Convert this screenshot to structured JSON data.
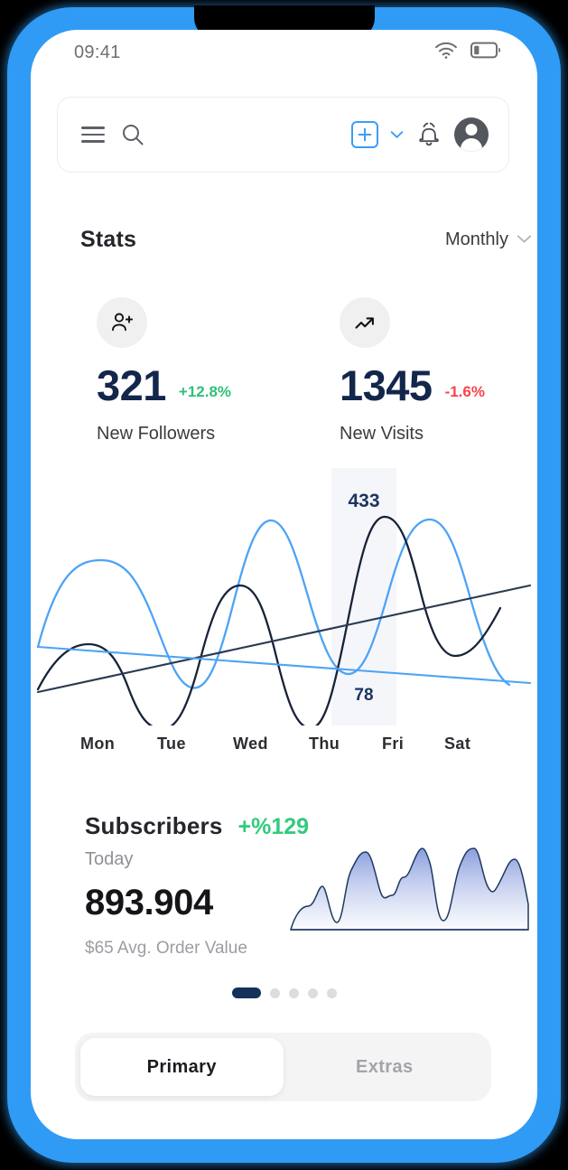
{
  "device": {
    "frame_color": "#2f9bf5",
    "screen_bg": "#ffffff"
  },
  "status_bar": {
    "time": "09:41",
    "wifi_icon": "wifi-icon",
    "battery_icon": "battery-low-icon",
    "battery_level_pct": 22
  },
  "app_bar": {
    "menu_icon": "hamburger-menu-icon",
    "search_icon": "search-icon",
    "add_icon": "plus-icon",
    "add_dropdown_icon": "chevron-down-icon",
    "notifications_icon": "bell-icon",
    "avatar_icon": "user-avatar-icon",
    "accent_color": "#3b9dfa"
  },
  "stats": {
    "title": "Stats",
    "period": {
      "label": "Monthly",
      "chevron_icon": "chevron-down-icon"
    },
    "cards": [
      {
        "icon": "person-add-icon",
        "value": "321",
        "delta": "+12.8%",
        "delta_direction": "up",
        "delta_color": "#2fc07a",
        "label": "New Followers"
      },
      {
        "icon": "trending-up-icon",
        "value": "1345",
        "delta": "-1.6%",
        "delta_direction": "down",
        "delta_color": "#f9434a",
        "label": "New Visits"
      }
    ]
  },
  "chart_data": {
    "type": "line",
    "title": "",
    "xlabel": "",
    "ylabel": "",
    "grid": false,
    "legend": "none",
    "categories": [
      "Mon",
      "Tue",
      "Wed",
      "Thu",
      "Fri",
      "Sat"
    ],
    "highlight": {
      "category": "Fri",
      "band_color": "#f5f6fa",
      "top_value": "433",
      "bottom_value": "78",
      "value_color": "#1c3461"
    },
    "series": [
      {
        "name": "series-light-blue-wave",
        "color": "#4da3f5",
        "values": [
          32,
          68,
          60,
          6,
          96,
          52,
          92,
          38
        ]
      },
      {
        "name": "series-dark-navy-wave",
        "color": "#182338",
        "values": [
          12,
          44,
          46,
          2,
          74,
          26,
          98,
          30
        ]
      },
      {
        "name": "series-dark-trend-line",
        "color": "#2b3a52",
        "values": [
          8,
          74
        ]
      },
      {
        "name": "series-light-trend-line",
        "color": "#4da3f5",
        "values": [
          36,
          20
        ]
      }
    ]
  },
  "subscribers": {
    "title": "Subscribers",
    "growth": "+%129",
    "growth_color": "#32cb7d",
    "period": "Today",
    "value": "893.904",
    "footnote": "$65 Avg. Order Value",
    "spark_chart": {
      "type": "area",
      "stroke_color": "#1e3a5f",
      "fill_top_color": "#8a9ede",
      "fill_bottom_color": "#f6f8fd",
      "values": [
        2,
        4,
        34,
        10,
        62,
        16,
        44,
        34,
        70,
        6,
        66,
        28,
        56,
        10
      ]
    }
  },
  "pager": {
    "total": 5,
    "active_index": 0,
    "active_color": "#14315c",
    "inactive_color": "#dcdde1"
  },
  "segmented_control": {
    "active_index": 0,
    "tabs": [
      {
        "label": "Primary"
      },
      {
        "label": "Extras"
      }
    ]
  }
}
